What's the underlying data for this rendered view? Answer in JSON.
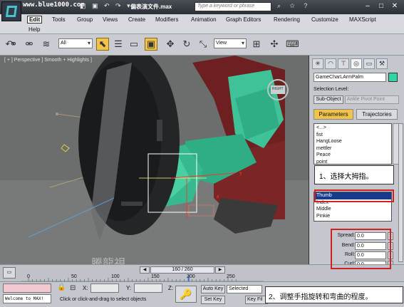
{
  "titlebar": {
    "watermark_url": "www.blue1000.com",
    "file_title": "偏表演文件.max",
    "search_placeholder": "Type a keyword or phrase"
  },
  "menu": {
    "items": [
      "Edit",
      "Tools",
      "Group",
      "Views",
      "Create",
      "Modifiers",
      "Animation",
      "Graph Editors",
      "Rendering",
      "Customize",
      "MAXScript"
    ],
    "help": "Help",
    "active": "Edit"
  },
  "toolbar": {
    "selection_filter": "All",
    "reference_coord": "View"
  },
  "viewport": {
    "label": "[ + ] Perspective ] Smooth + Highlights ]",
    "watermark": "騰龍視",
    "nav_cube": "RIGHT",
    "axis_y": "y",
    "axis_x": "x"
  },
  "command_panel": {
    "object_name": "GameCharLArmPalm",
    "selection_level_label": "Selection Level:",
    "sub_object_label": "Sub-Object",
    "pivot_label": "Ankle Pivot Point",
    "tabs": [
      "Parameters",
      "Trajectories"
    ],
    "active_tab": "Parameters",
    "list_top": [
      "<...>",
      "fist",
      "HangLoose",
      "mettler",
      "Peace",
      "point"
    ],
    "list_bottom": [
      "Thumb",
      "Index",
      "Middle",
      "Pinkie"
    ],
    "selected_finger": "Thumb",
    "params": [
      {
        "label": "Spread:",
        "value": "0.0"
      },
      {
        "label": "Bend:",
        "value": "0.0"
      },
      {
        "label": "Roll:",
        "value": "0.0"
      },
      {
        "label": "Curl:",
        "value": "0.0"
      }
    ]
  },
  "callouts": {
    "step1": "1、选择大拇指。",
    "step2": "2、调整手指旋转和弯曲的程度。"
  },
  "timeline": {
    "slider_label": "160 / 260",
    "ticks": [
      "0",
      "50",
      "100",
      "150",
      "200",
      "250"
    ]
  },
  "statusbar": {
    "welcome": "Welcome to MAX!",
    "x_label": "X:",
    "y_label": "Y:",
    "z_label": "Z:",
    "prompt": "Click or click-and-drag to select objects",
    "auto_key": "Auto Key",
    "set_key": "Set Key",
    "selected": "Selected",
    "key_filters": "Key Fil"
  },
  "colors": {
    "accent": "#f2c34a",
    "hand_green": "#2fae86",
    "arm_red": "#7a2323",
    "callout_border": "#d02020"
  }
}
